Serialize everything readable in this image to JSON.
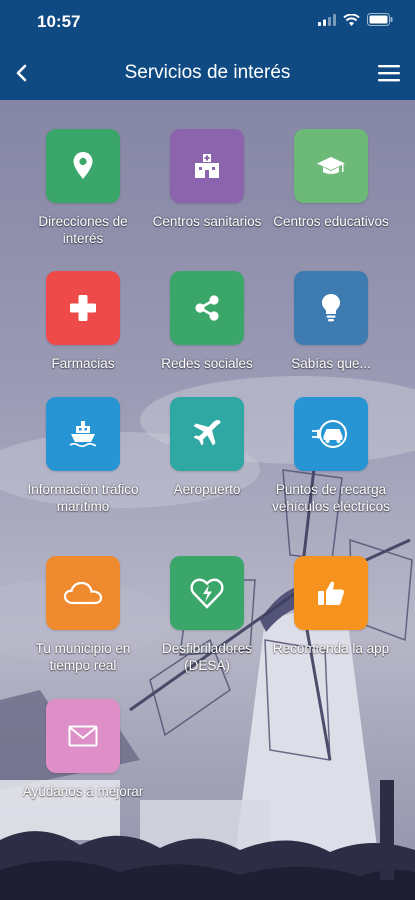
{
  "status_bar": {
    "time": "10:57"
  },
  "header": {
    "title": "Servicios de interés"
  },
  "icons": {
    "back": "chevron-left-icon",
    "menu": "hamburger-menu-icon",
    "signal": "cellular-signal-icon",
    "wifi": "wifi-icon",
    "battery": "battery-icon"
  },
  "colors": {
    "header_bg": "#0f4a83",
    "green": "#3aa66a",
    "purple": "#8c63ad",
    "light_green": "#6cb978",
    "red": "#ee4a4a",
    "blue": "#3d7bb0",
    "teal": "#2fa7a2",
    "cyan_blue": "#2795d4",
    "orange": "#f08a2f",
    "amber": "#f6931e",
    "pink": "#df8fc7"
  },
  "services": [
    {
      "label": "Direcciones de interés",
      "icon": "location-pin-icon"
    },
    {
      "label": "Centros sanitarios",
      "icon": "hospital-icon"
    },
    {
      "label": "Centros educativos",
      "icon": "graduation-cap-icon"
    },
    {
      "label": "Farmacias",
      "icon": "pharmacy-cross-icon"
    },
    {
      "label": "Redes sociales",
      "icon": "share-icon"
    },
    {
      "label": "Sabías que...",
      "icon": "lightbulb-icon"
    },
    {
      "label": "Información tráfico marítimo",
      "icon": "ship-icon"
    },
    {
      "label": "Aeropuerto",
      "icon": "airplane-icon"
    },
    {
      "label": "Puntos de recarga vehículos eléctricos",
      "icon": "ev-charging-icon"
    },
    {
      "label": "Tu municipio en tiempo real",
      "icon": "cloud-icon"
    },
    {
      "label": "Desfibriladores (DESA)",
      "icon": "defibrillator-heart-icon"
    },
    {
      "label": "Recomienda la app",
      "icon": "thumbs-up-icon"
    },
    {
      "label": "Ayúdanos a mejorar",
      "icon": "envelope-icon"
    }
  ]
}
